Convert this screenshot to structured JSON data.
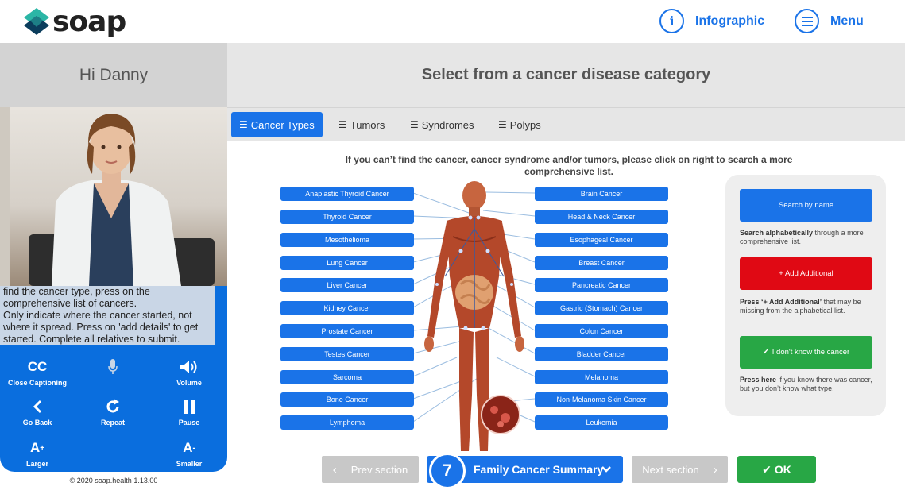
{
  "header": {
    "logo_text": "soap",
    "infographic_label": "Infographic",
    "menu_label": "Menu"
  },
  "left": {
    "greeting": "Hi Danny",
    "transcript_lines": [
      "find the cancer type, press on the",
      "comprehensive list of cancers.",
      "Only indicate where the cancer started, not",
      "where it spread. Press on 'add details' to get",
      "started. Complete all relatives to submit."
    ],
    "controls": {
      "cc_icon": "CC",
      "cc_label": "Close Captioning",
      "volume_label": "Volume",
      "back_label": "Go Back",
      "repeat_label": "Repeat",
      "pause_label": "Pause",
      "larger_label": "Larger",
      "smaller_label": "Smaller"
    },
    "copyright": "© 2020 soap.health 1.13.00"
  },
  "main": {
    "title": "Select from a cancer disease category",
    "tabs": [
      {
        "label": "Cancer Types",
        "active": true
      },
      {
        "label": "Tumors",
        "active": false
      },
      {
        "label": "Syndromes",
        "active": false
      },
      {
        "label": "Polyps",
        "active": false
      }
    ],
    "instruction": "If you can’t find the cancer, cancer syndrome and/or tumors, please click on right to search a more comprehensive list.",
    "left_cancers": [
      "Anaplastic Thyroid Cancer",
      "Thyroid Cancer",
      "Mesothelioma",
      "Lung Cancer",
      "Liver Cancer",
      "Kidney Cancer",
      "Prostate Cancer",
      "Testes Cancer",
      "Sarcoma",
      "Bone Cancer",
      "Lymphoma"
    ],
    "right_cancers": [
      "Brain Cancer",
      "Head & Neck Cancer",
      "Esophageal Cancer",
      "Breast Cancer",
      "Pancreatic Cancer",
      "Gastric (Stomach) Cancer",
      "Colon Cancer",
      "Bladder Cancer",
      "Melanoma",
      "Non-Melanoma Skin Cancer",
      "Leukemia"
    ]
  },
  "side": {
    "search_label": "Search by name",
    "search_desc_bold": "Search alphabetically",
    "search_desc": " through a more comprehensive list.",
    "add_label": "+ Add Additional",
    "add_desc_bold": "Press ‘+ Add Additional’",
    "add_desc": " that may be missing from the alphabetical list.",
    "unknown_label": "I don't know the cancer",
    "unknown_desc_bold": "Press here",
    "unknown_desc": " if you know there was cancer, but you don’t know what type."
  },
  "footer": {
    "prev_label": "Prev section",
    "next_label": "Next section",
    "step_number": "7",
    "summary_label": "Family Cancer Summary",
    "ok_label": "OK"
  },
  "colors": {
    "primary": "#1a73e8",
    "danger": "#e00914",
    "success": "#28a745",
    "disabled": "#c8c8c8"
  }
}
